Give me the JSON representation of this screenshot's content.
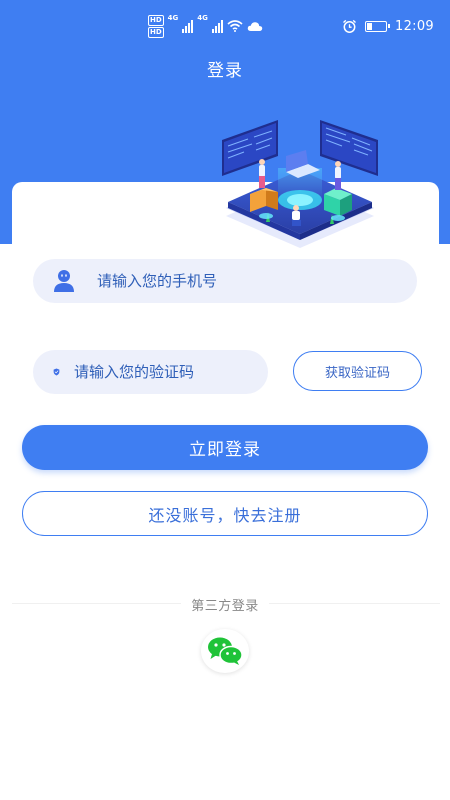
{
  "status_bar": {
    "hd1": "HD",
    "hd2": "HD",
    "network1": "4G",
    "network2": "4G",
    "time": "12:09",
    "battery_level": 0.3,
    "icons": [
      "hd-icon",
      "signal-icon",
      "wifi-icon",
      "cloud-icon",
      "alarm-icon",
      "battery-icon"
    ]
  },
  "header": {
    "title": "登录",
    "background_color": "#3f7ef2"
  },
  "form": {
    "phone_placeholder": "请输入您的手机号",
    "code_placeholder": "请输入您的验证码",
    "get_code_label": "获取验证码",
    "login_label": "立即登录",
    "register_label": "还没账号，快去注册"
  },
  "third_party": {
    "label": "第三方登录",
    "providers": [
      "wechat"
    ]
  },
  "colors": {
    "accent": "#3f7ef2",
    "input_bg": "#edf0fb",
    "wechat_green": "#1fc338"
  }
}
